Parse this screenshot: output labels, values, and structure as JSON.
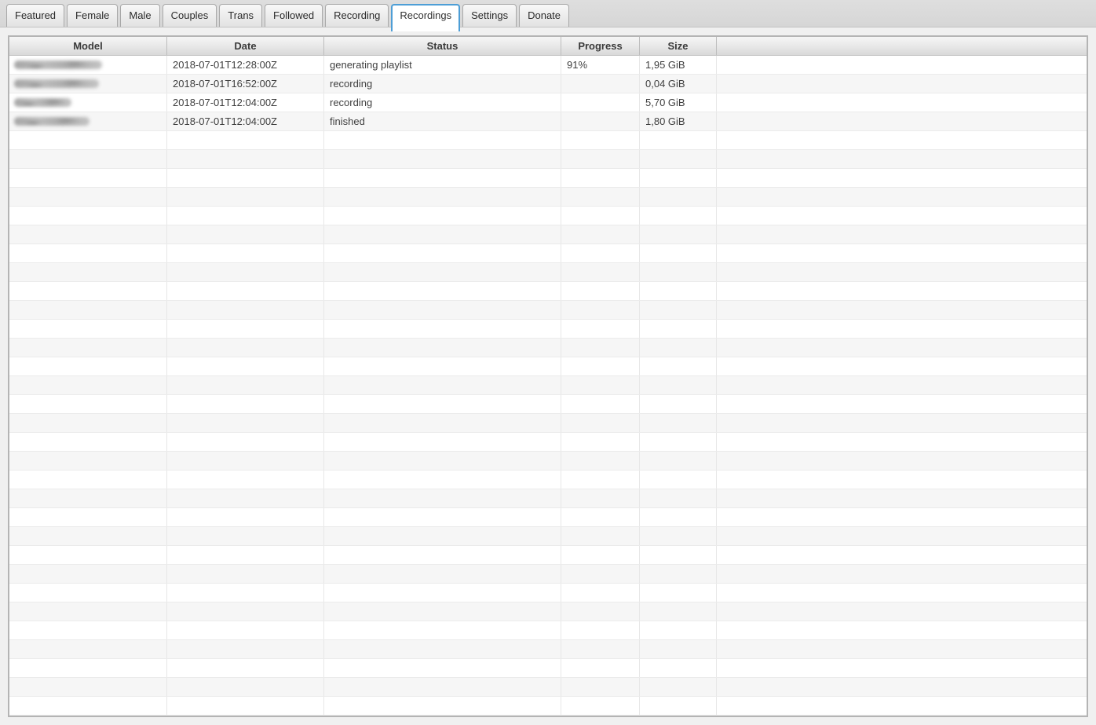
{
  "tabs": [
    {
      "label": "Featured",
      "active": false
    },
    {
      "label": "Female",
      "active": false
    },
    {
      "label": "Male",
      "active": false
    },
    {
      "label": "Couples",
      "active": false
    },
    {
      "label": "Trans",
      "active": false
    },
    {
      "label": "Followed",
      "active": false
    },
    {
      "label": "Recording",
      "active": false
    },
    {
      "label": "Recordings",
      "active": true
    },
    {
      "label": "Settings",
      "active": false
    },
    {
      "label": "Donate",
      "active": false
    }
  ],
  "table": {
    "columns": [
      {
        "key": "model",
        "label": "Model"
      },
      {
        "key": "date",
        "label": "Date"
      },
      {
        "key": "status",
        "label": "Status"
      },
      {
        "key": "progress",
        "label": "Progress"
      },
      {
        "key": "size",
        "label": "Size"
      },
      {
        "key": "filler",
        "label": ""
      }
    ],
    "rows": [
      {
        "model": "",
        "model_redacted": true,
        "redaction_width": 112,
        "date": "2018-07-01T12:28:00Z",
        "status": "generating playlist",
        "progress": "91%",
        "size": "1,95 GiB"
      },
      {
        "model": "",
        "model_redacted": true,
        "redaction_width": 108,
        "date": "2018-07-01T16:52:00Z",
        "status": "recording",
        "progress": "",
        "size": "0,04 GiB"
      },
      {
        "model": "",
        "model_redacted": true,
        "redaction_width": 73,
        "date": "2018-07-01T12:04:00Z",
        "status": "recording",
        "progress": "",
        "size": "5,70 GiB"
      },
      {
        "model": "",
        "model_redacted": true,
        "redaction_width": 96,
        "date": "2018-07-01T12:04:00Z",
        "status": "finished",
        "progress": "",
        "size": "1,80 GiB"
      }
    ],
    "empty_row_count": 31
  },
  "colors": {
    "active_tab_border": "#4d9ed6",
    "row_stripe": "#f6f6f6"
  }
}
